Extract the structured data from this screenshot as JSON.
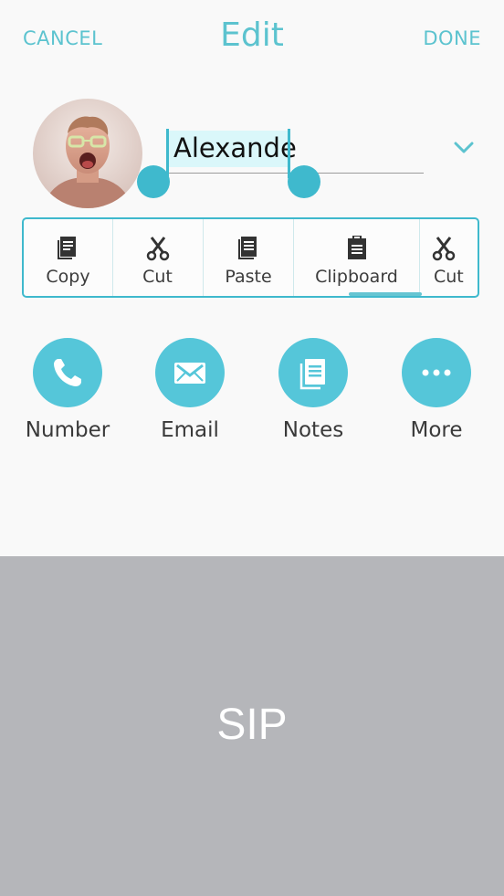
{
  "header": {
    "cancel_label": "CANCEL",
    "title": "Edit",
    "done_label": "DONE"
  },
  "contact": {
    "name_value": "Alexande"
  },
  "context_menu": {
    "items": [
      {
        "label": "Copy",
        "icon": "copy-icon"
      },
      {
        "label": "Cut",
        "icon": "scissors-icon"
      },
      {
        "label": "Paste",
        "icon": "paste-icon"
      },
      {
        "label": "Clipboard",
        "icon": "clipboard-icon"
      },
      {
        "label": "Cut",
        "icon": "scissors-icon"
      }
    ]
  },
  "actions": [
    {
      "label": "Number",
      "icon": "phone-icon"
    },
    {
      "label": "Email",
      "icon": "mail-icon"
    },
    {
      "label": "Notes",
      "icon": "notes-icon"
    },
    {
      "label": "More",
      "icon": "more-icon"
    }
  ],
  "keyboard": {
    "label": "SIP"
  },
  "colors": {
    "accent": "#5cc3cf",
    "selection_handle": "#3fb9cd",
    "action_circle": "#55c6d9",
    "keyboard_bg": "#b5b6ba"
  }
}
